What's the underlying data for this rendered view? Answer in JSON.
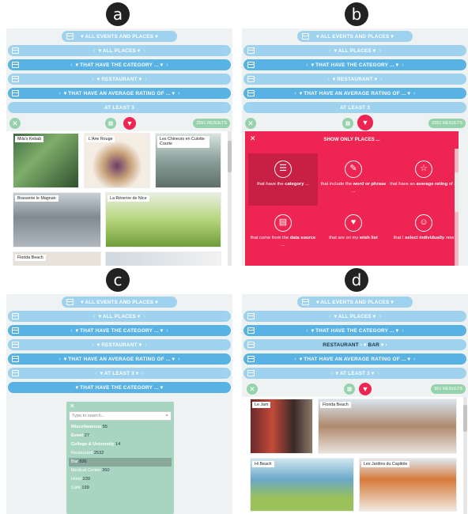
{
  "labels": [
    "a",
    "b",
    "c",
    "d"
  ],
  "filters": {
    "events": "ALL EVENTS AND PLACES",
    "places": "ALL PLACES",
    "category": "THAT HAVE THE CATEGORY ...",
    "restaurant": "RESTAURANT",
    "rating": "THAT HAVE AN AVERAGE RATING OF ...",
    "atleast": "AT LEAST 3",
    "category2": "THAT HAVE THE CATEGORY ...",
    "restaurant_d": "RESTAURANT",
    "bar_d": "BAR"
  },
  "results": {
    "a": "2551 RESULTS",
    "b": "2551 RESULTS",
    "d": "961 RESULTS"
  },
  "colors": {
    "light": "#9fd2ee",
    "dark": "#59b2e4",
    "accent": "#ee2452",
    "green": "#96d3ac"
  },
  "panel_a": {
    "places": [
      "Mila's Kebab",
      "L'Ane Rouge",
      "Les Chineurs en Culotte Courte",
      "Brasserie le Magnan",
      "La Réserve de Nice",
      "Florida Beach"
    ]
  },
  "panel_b": {
    "title": "SHOW ONLY PLACES ...",
    "options": [
      {
        "icon": "list-icon",
        "text": "that have the ",
        "bold": "category",
        "text2": " ..."
      },
      {
        "icon": "pencil-icon",
        "text": "that include the ",
        "bold": "word or phrase",
        "text2": " ..."
      },
      {
        "icon": "star-icon",
        "text": "that have an ",
        "bold": "average rating",
        "text2": " of ..."
      },
      {
        "icon": "database-icon",
        "text": "that come from the ",
        "bold": "data source",
        "text2": " ..."
      },
      {
        "icon": "heart-icon",
        "text": "that are on my ",
        "bold": "wish list",
        "text2": ""
      },
      {
        "icon": "person-icon",
        "text": "that I ",
        "bold": "select individually",
        "text2": " now"
      }
    ]
  },
  "panel_c": {
    "search_placeholder": "Type to search...",
    "items": [
      {
        "name": "Miscellaneous",
        "count": "55",
        "bold": true
      },
      {
        "name": "Event",
        "count": "27",
        "bold": true
      },
      {
        "name": "College & University",
        "count": "14",
        "bold": true
      },
      {
        "name": "Restaurant",
        "count": "2532",
        "bold": false
      },
      {
        "name": "Bar",
        "count": "836",
        "bold": false,
        "selected": true
      },
      {
        "name": "Medical Center",
        "count": "260",
        "bold": false
      },
      {
        "name": "Hotel",
        "count": "239",
        "bold": false
      },
      {
        "name": "Café",
        "count": "199",
        "bold": false
      }
    ]
  },
  "panel_d": {
    "places": [
      "Le Jam",
      "Florida Beach",
      "Hi Beach",
      "Les Jardins du Capitole"
    ]
  }
}
